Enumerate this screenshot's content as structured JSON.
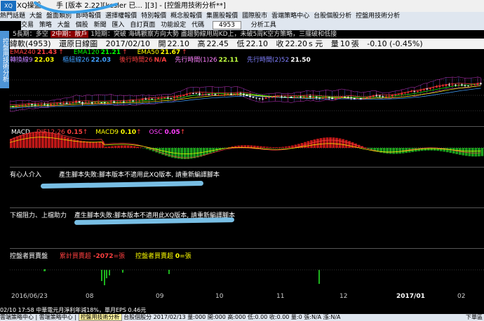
{
  "window": {
    "app_name": "XQ操盤",
    "doc_title": "手 [版本 2.22][kesler 已... ][3] - [控盤用技術分析**]"
  },
  "menu_tabs": [
    "熱門話題",
    "大盤",
    "盤面類別",
    "即時報價",
    "選擇權報價",
    "特別報價",
    "概念股報價",
    "集團股報價",
    "國際股市",
    "雲端策略中心",
    "台股個股分析",
    "控盤用技術分析"
  ],
  "toolbar": {
    "items": [
      "交易",
      "策略",
      "大盤",
      "個股",
      "新聞",
      "匯入",
      "自訂頁面",
      "功能設定",
      "代碼"
    ],
    "code_value": "4953",
    "analysis_tool": "分析工具"
  },
  "vertical_tab": "控盤用技術分析",
  "info_strip": {
    "parts": [
      "5長期：多空",
      "2中期：散戶",
      "1短期：突破",
      "海碼觀察方向大勢",
      "盡趨勢線用周KD上，未破5周K空方策略，三擺破和低接"
    ],
    "highlight": "2中期：散戶"
  },
  "quote": {
    "name": "緯軟(4953)",
    "type": "還原日線圖",
    "date": "2017/02/10",
    "open_label": "開",
    "open": "22.10",
    "high_label": "高",
    "high": "22.45",
    "low_label": "低",
    "low": "22.10",
    "close_label": "收",
    "close": "22.20",
    "close_unit": "s 元",
    "vol_label": "量",
    "vol": "10",
    "vol_unit": "張",
    "change": "-0.10 (-0.45%)"
  },
  "ema_row": [
    {
      "label": "EMA240",
      "value": "21.43",
      "color": "#ff4040"
    },
    {
      "label": "EMA120",
      "value": "21.21",
      "color": "#00ff00"
    },
    {
      "label": "EMA50",
      "value": "21.67",
      "color": "#ffff00"
    }
  ],
  "line_row": [
    {
      "label": "轉換線9",
      "value": "22.03",
      "color": "#ffff00",
      "lcolor": "#c080ff"
    },
    {
      "label": "樞紐線26",
      "value": "22.03",
      "color": "#40a0ff",
      "lcolor": "#40a0ff"
    },
    {
      "label": "後行時間26",
      "value": "N/A",
      "color": "#ff4040",
      "lcolor": "#ff4040"
    },
    {
      "label": "先行時間(1)26",
      "value": "22.11",
      "color": "#c0ff40",
      "lcolor": "#ff80ff"
    },
    {
      "label": "先行時間(2)52",
      "value": "21.50",
      "color": "#ffffff",
      "lcolor": "#8080ff"
    }
  ],
  "macd": {
    "title": "MACD",
    "dif_label": "DIF12-26",
    "dif_value": "0.15",
    "macd_label": "MACD9",
    "macd_value": "0.10",
    "osc_label": "OSC",
    "osc_value": "0.05"
  },
  "panel_a": {
    "title": "有心人介入",
    "error": "產生腳本失敗:腳本版本不適用此XQ版本, 請重新編譯腳本"
  },
  "panel_b": {
    "title": "下檔阻力、上檔助力",
    "error": "產生腳本失敗:腳本版本不適用此XQ版本, 請重新編譯腳本"
  },
  "panel_c": {
    "title": "控盤者買賣盤",
    "cum_label": "累計買賣超",
    "cum_value": "-2072",
    "cum_unit": "=張",
    "today_label": "控盤者買賣超",
    "today_value": "0",
    "today_unit": "=張"
  },
  "x_labels": [
    "2016/06/23",
    "08",
    "09",
    "10",
    "11",
    "12",
    "2017/01",
    "02"
  ],
  "status_line": "02/10 17:58   中華電元月淨利年減18%，單月EPS 0.46元",
  "status_bar": {
    "tabs": [
      "雲端策略中心",
      "雲端策略中心",
      "控盤用技術分析",
      "台股個股分"
    ],
    "selected_tab": "控盤用技術分析",
    "tail": "2017/02/13 量:000 開:000 高:000 低:0.00 收:0.00 量:0 張:N/A 漲:N/A",
    "right": "下單區"
  },
  "colors": {
    "up": "#ff3030",
    "down": "#ffffff",
    "accent": "#4d94d6"
  }
}
